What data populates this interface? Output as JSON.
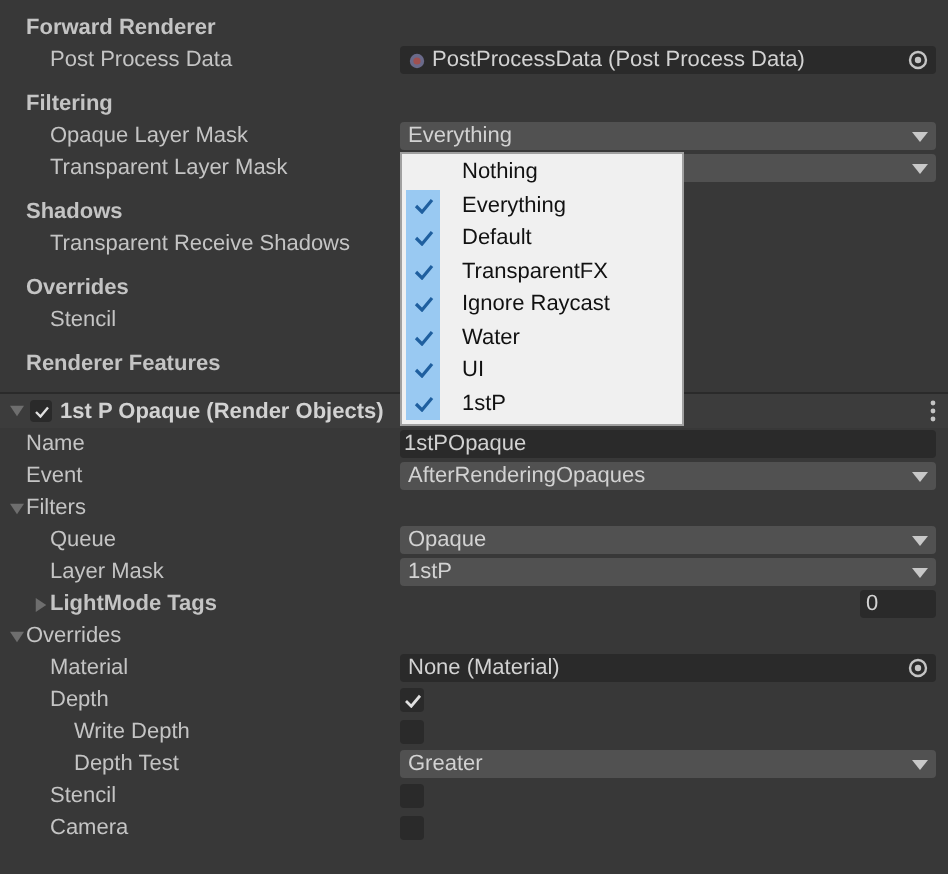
{
  "sections": [
    {
      "label": "Forward Renderer",
      "children": [
        {
          "label": "Post Process Data",
          "kind": "object",
          "value": "PostProcessData (Post Process Data)"
        }
      ]
    },
    {
      "label": "Filtering",
      "children": [
        {
          "label": "Opaque Layer Mask",
          "kind": "dropdown",
          "value": "Everything"
        },
        {
          "label": "Transparent Layer Mask",
          "kind": "dropdown"
        }
      ]
    },
    {
      "label": "Shadows",
      "children": [
        {
          "label": "Transparent Receive Shadows",
          "kind": "label"
        }
      ]
    },
    {
      "label": "Overrides",
      "children": [
        {
          "label": "Stencil",
          "kind": "label"
        }
      ]
    },
    {
      "label": "Renderer Features"
    }
  ],
  "feature": {
    "title": "1st P Opaque (Render Objects)",
    "enabled": true,
    "expanded": true,
    "fields": [
      {
        "label": "Name",
        "kind": "text",
        "value": "1stPOpaque"
      },
      {
        "label": "Event",
        "kind": "dropdown",
        "value": "AfterRenderingOpaques"
      },
      {
        "label": "Filters",
        "kind": "foldout",
        "expanded": true,
        "children": [
          {
            "label": "Queue",
            "kind": "dropdown",
            "value": "Opaque"
          },
          {
            "label": "Layer Mask",
            "kind": "dropdown",
            "value": "1stP"
          },
          {
            "label": "LightMode Tags",
            "kind": "foldout",
            "expanded": false,
            "bold": true,
            "value": "0"
          }
        ]
      },
      {
        "label": "Overrides",
        "kind": "foldout",
        "expanded": true,
        "children": [
          {
            "label": "Material",
            "kind": "object",
            "value": "None (Material)"
          },
          {
            "label": "Depth",
            "kind": "checkbox",
            "checked": true,
            "children": [
              {
                "label": "Write Depth",
                "kind": "checkbox",
                "checked": false
              },
              {
                "label": "Depth Test",
                "kind": "dropdown",
                "value": "Greater"
              }
            ]
          },
          {
            "label": "Stencil",
            "kind": "checkbox",
            "checked": false
          },
          {
            "label": "Camera",
            "kind": "checkbox",
            "checked": false
          }
        ]
      }
    ]
  },
  "popup": {
    "items": [
      {
        "label": "Nothing",
        "checked": false
      },
      {
        "label": "Everything",
        "checked": true
      },
      {
        "label": "Default",
        "checked": true
      },
      {
        "label": "TransparentFX",
        "checked": true
      },
      {
        "label": "Ignore Raycast",
        "checked": true
      },
      {
        "label": "Water",
        "checked": true
      },
      {
        "label": "UI",
        "checked": true
      },
      {
        "label": "1stP",
        "checked": true
      }
    ]
  }
}
